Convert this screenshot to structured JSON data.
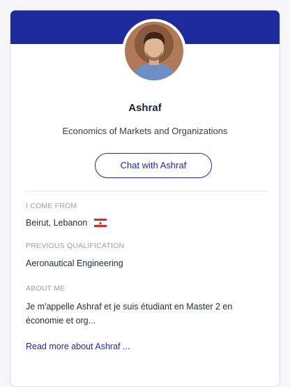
{
  "profile": {
    "name": "Ashraf",
    "program": "Economics of Markets and Organizations",
    "chat_label": "Chat with Ashraf",
    "origin_label": "I COME FROM",
    "origin_value": "Beirut, Lebanon",
    "qualification_label": "PREVIOUS QUALIFICATION",
    "qualification_value": "Aeronautical Engineering",
    "about_label": "ABOUT ME",
    "about_value": "Je m'appelle Ashraf et je suis étudiant en Master 2 en économie et org...",
    "read_more_label": "Read more about Ashraf ..."
  },
  "colors": {
    "brand": "#1c2a9c",
    "flag_red": "#e0262d",
    "flag_green": "#1a9b3a"
  },
  "icons": {
    "flag": "lebanon-flag-icon",
    "avatar": "profile-photo"
  }
}
